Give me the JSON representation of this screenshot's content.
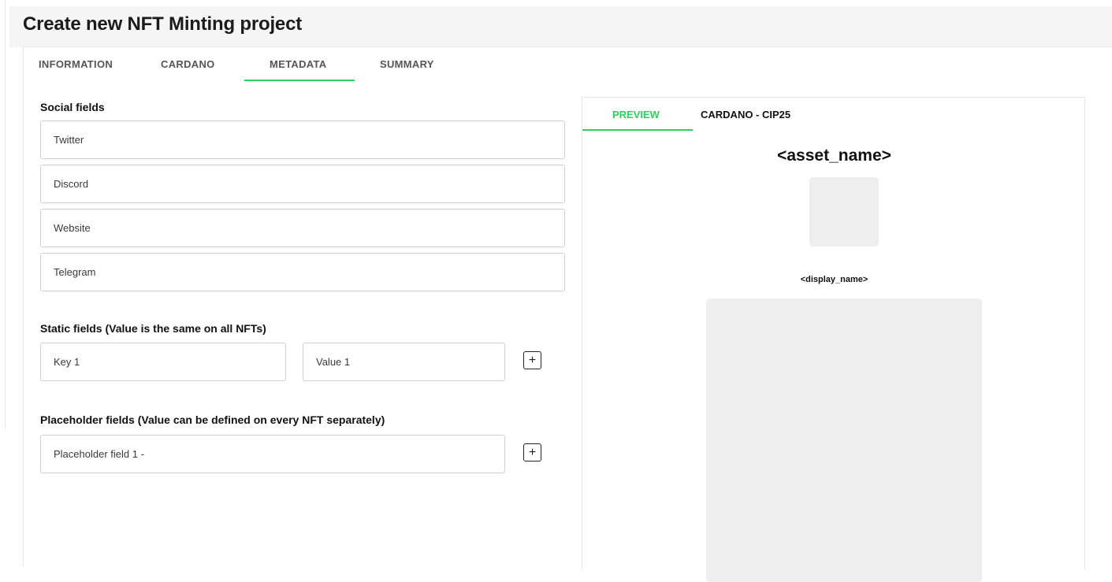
{
  "header": {
    "title": "Create new NFT Minting project"
  },
  "tabs": [
    {
      "label": "INFORMATION"
    },
    {
      "label": "CARDANO"
    },
    {
      "label": "METADATA",
      "active": true
    },
    {
      "label": "SUMMARY"
    }
  ],
  "social": {
    "title": "Social fields",
    "twitter_placeholder": "Twitter",
    "discord_placeholder": "Discord",
    "website_placeholder": "Website",
    "telegram_placeholder": "Telegram"
  },
  "static_fields": {
    "title": "Static fields (Value is the same on all NFTs)",
    "key_placeholder": "Key 1",
    "value_placeholder": "Value 1",
    "add_label": "+"
  },
  "placeholder_fields": {
    "title": "Placeholder fields (Value can be defined on every NFT separately)",
    "field_placeholder": "Placeholder field 1 -",
    "add_label": "+"
  },
  "preview": {
    "tabs": [
      {
        "label": "PREVIEW",
        "active": true
      },
      {
        "label": "CARDANO - CIP25"
      }
    ],
    "asset_name": "<asset_name>",
    "display_name": "<display_name>"
  },
  "colors": {
    "accent": "#2ecf5a",
    "image_placeholder": "#eeeeee",
    "header_bg": "#f5f5f5"
  }
}
